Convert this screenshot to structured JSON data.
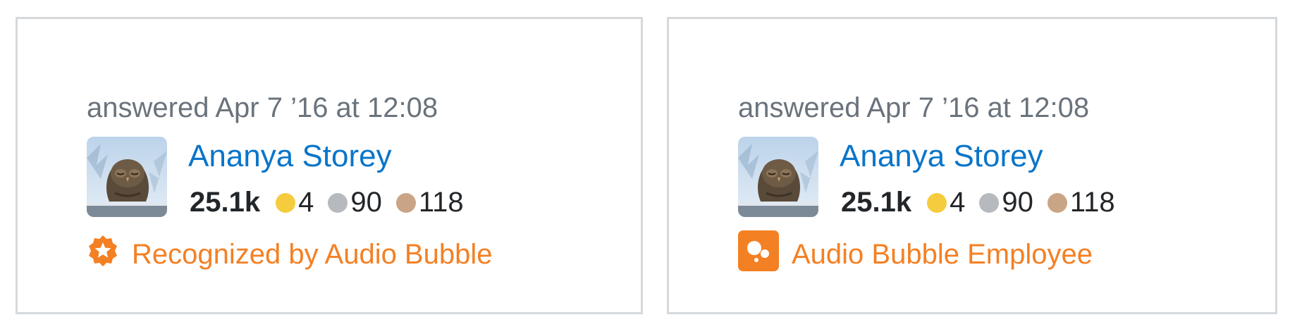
{
  "colors": {
    "border": "#d6d9dc",
    "meta_text": "#6a737c",
    "link": "#0a75c9",
    "accent": "#f48024",
    "gold": "#f5cc3d",
    "silver": "#b6babe",
    "bronze": "#c9a586"
  },
  "cards": [
    {
      "answered_label": "answered Apr 7 ’16 at 12:08",
      "user_name": "Ananya Storey",
      "avatar_icon": "owl-avatar",
      "reputation": "25.1k",
      "badges": {
        "gold": "4",
        "silver": "90",
        "bronze": "118"
      },
      "flair_icon": "star-badge-icon",
      "flair_text": "Recognized by Audio Bubble"
    },
    {
      "answered_label": "answered Apr 7 ’16 at 12:08",
      "user_name": "Ananya Storey",
      "avatar_icon": "owl-avatar",
      "reputation": "25.1k",
      "badges": {
        "gold": "4",
        "silver": "90",
        "bronze": "118"
      },
      "flair_icon": "audio-bubble-logo-icon",
      "flair_text": "Audio Bubble Employee"
    }
  ]
}
